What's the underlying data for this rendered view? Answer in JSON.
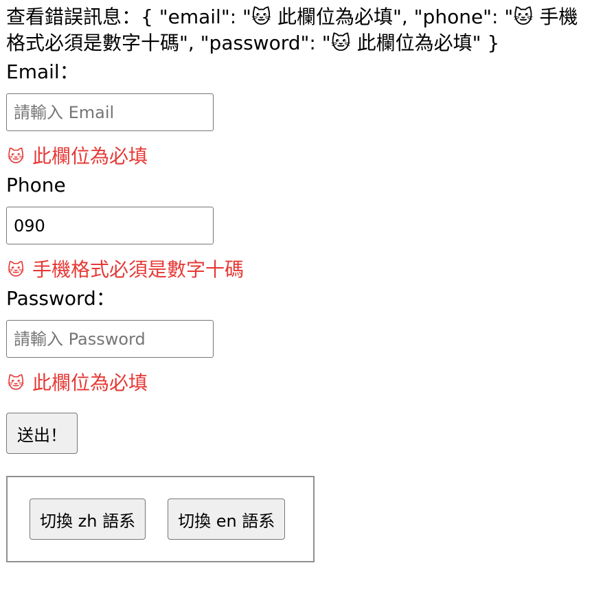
{
  "debug": {
    "text": "查看錯誤訊息：{ \"email\": \"🐱 此欄位為必填\", \"phone\": \"🐱 手機格式必須是數字十碼\", \"password\": \"🐱 此欄位為必填\" }"
  },
  "form": {
    "email": {
      "label": "Email：",
      "placeholder": "請輸入 Email",
      "value": "",
      "error_icon": "🐱",
      "error": "此欄位為必填"
    },
    "phone": {
      "label": "Phone",
      "placeholder": "",
      "value": "090",
      "error_icon": "🐱",
      "error": "手機格式必須是數字十碼"
    },
    "password": {
      "label": "Password：",
      "placeholder": "請輸入 Password",
      "value": "",
      "error_icon": "🐱",
      "error": "此欄位為必填"
    },
    "submit_label": "送出！"
  },
  "language": {
    "zh_label": "切換 zh 語系",
    "en_label": "切換 en 語系"
  },
  "colors": {
    "error": "#e53935",
    "button_bg": "#efefef",
    "border": "#767676"
  },
  "icons": {
    "error_icon_name": "cat-face-icon"
  }
}
